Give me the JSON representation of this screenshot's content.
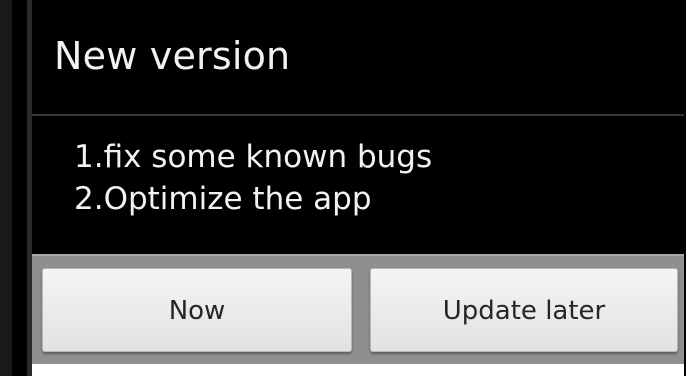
{
  "dialog": {
    "title": "New version",
    "message_lines": [
      "1.fix some known bugs",
      "2.Optimize the app"
    ],
    "buttons": {
      "now_label": "Now",
      "later_label": "Update later"
    }
  },
  "colors": {
    "dialog_background": "#000000",
    "text": "#f2f2f2",
    "button_bar": "#8f8f8f",
    "button_face": "#ececec",
    "button_text": "#262626"
  }
}
